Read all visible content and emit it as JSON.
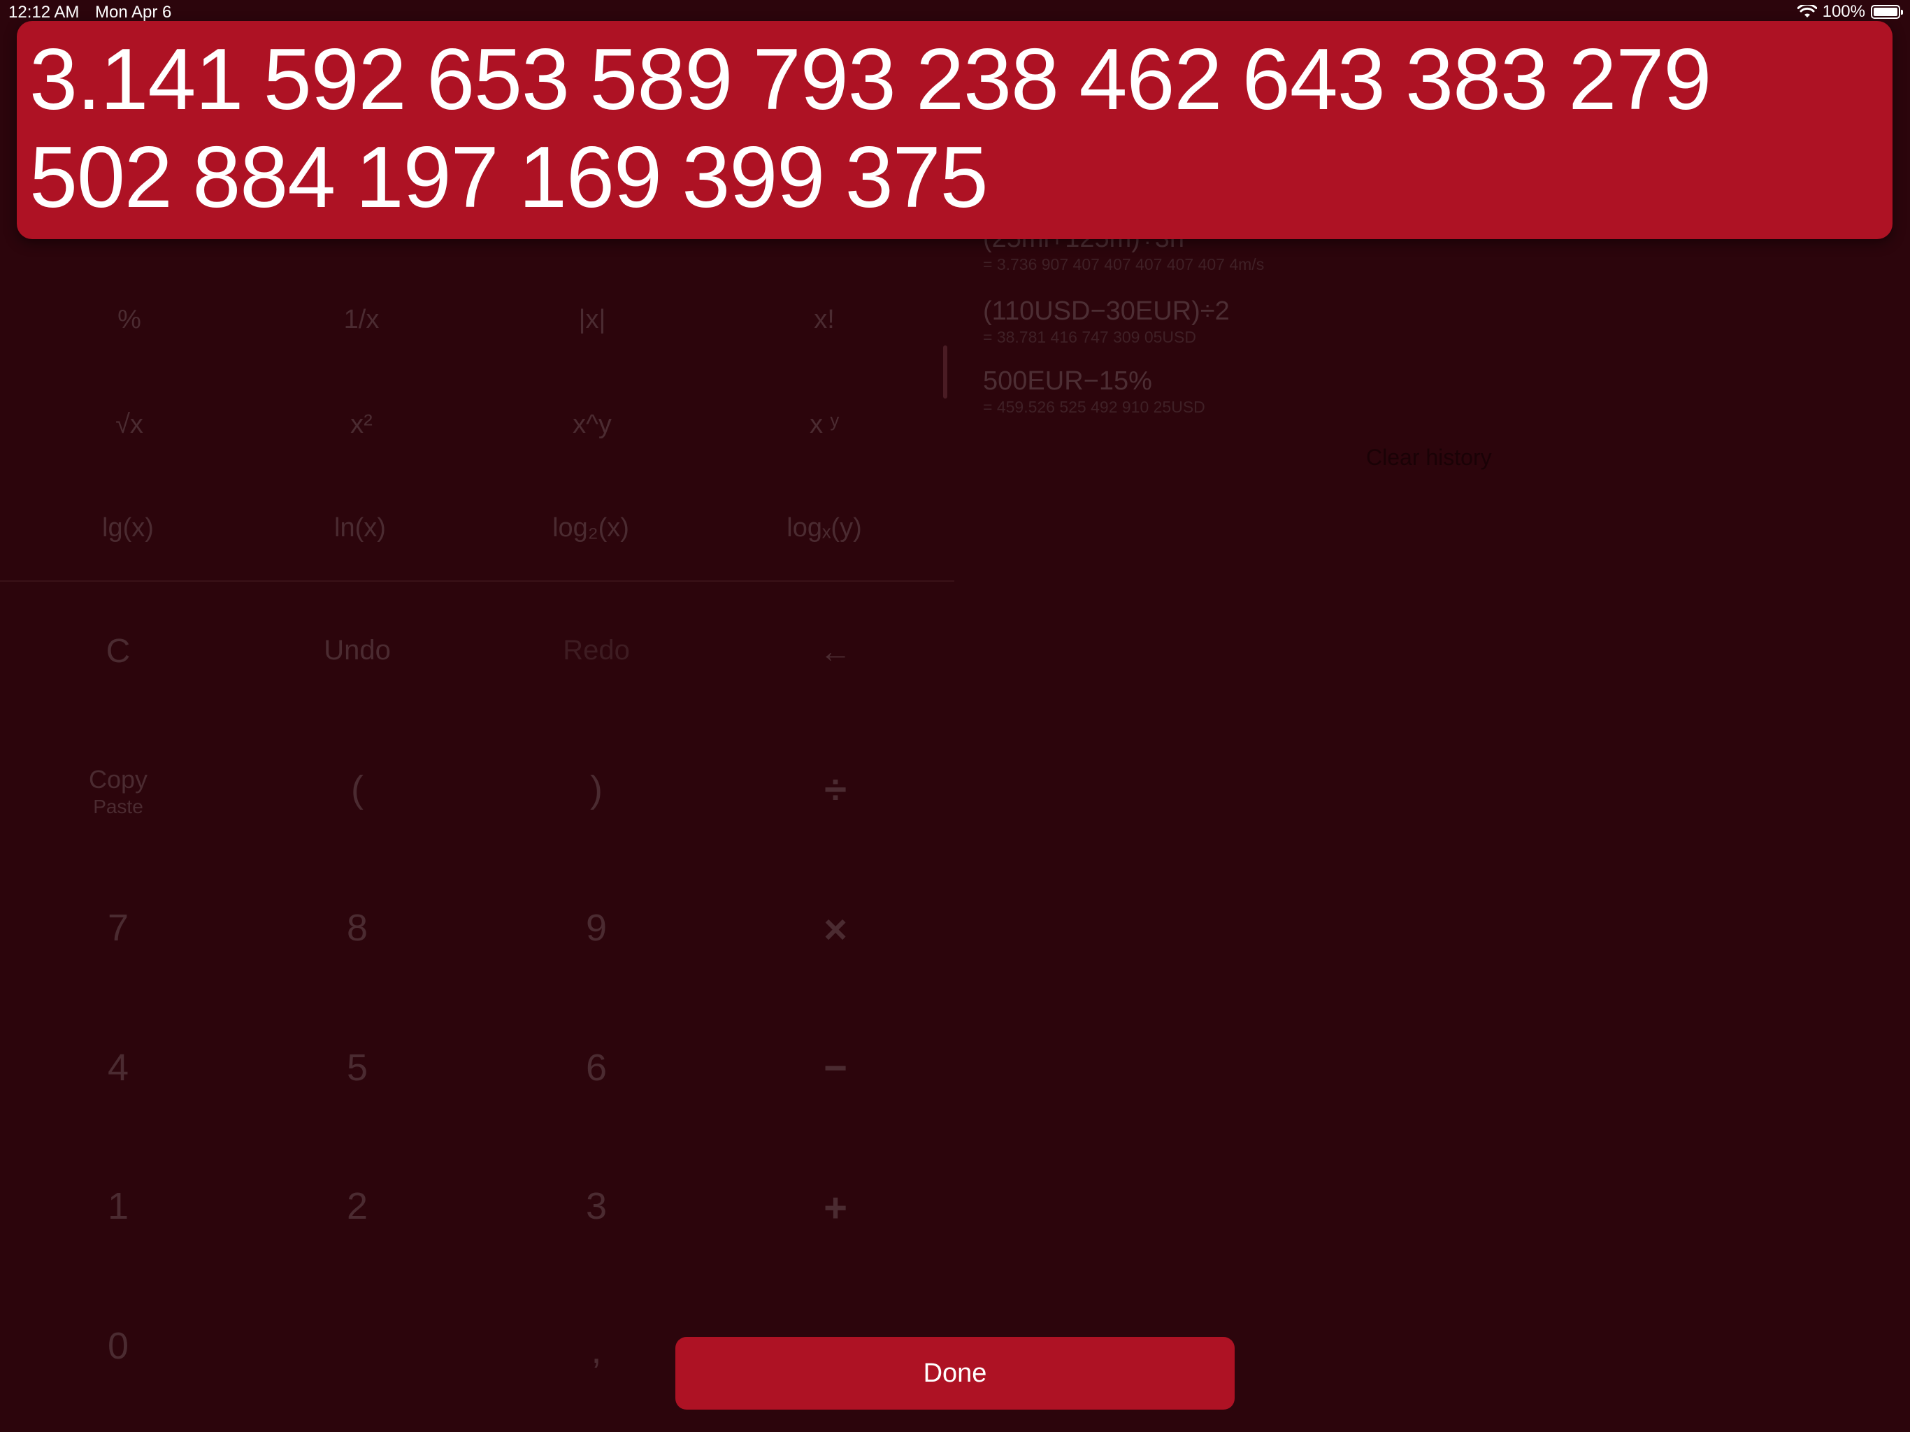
{
  "status_bar": {
    "time": "12:12 AM",
    "date": "Mon Apr 6",
    "battery": "100%"
  },
  "result": {
    "line1": "3.141 592 653 589 793 238 462 643 383 279",
    "line2": "502 884 197 169 399 375"
  },
  "history": {
    "items": [
      {
        "expr": "(25mi+125m)÷3h",
        "result": "= 3.736 907 407 407 407 407 407 4m/s"
      },
      {
        "expr": "(110USD−30EUR)÷2",
        "result": "= 38.781 416 747 309 05USD"
      },
      {
        "expr": "500EUR−15%",
        "result": "= 459.526 525 492 910 25USD"
      }
    ],
    "clear_label": "Clear history"
  },
  "keypad": {
    "functions": {
      "percent": "%",
      "reciprocal": "1/x",
      "abs": "|x|",
      "factorial": "x!",
      "sqrt": "√x",
      "square": "x²",
      "power": "x^y",
      "power_sup": "x ʸ",
      "lg": "lg(x)",
      "ln": "ln(x)",
      "log2": "log₂(x)",
      "logx": "logₓ(y)"
    },
    "controls": {
      "clear": "C",
      "undo": "Undo",
      "redo": "Redo",
      "backspace": "←",
      "copy": "Copy",
      "paste": "Paste",
      "open_paren": "(",
      "close_paren": ")",
      "divide": "÷",
      "multiply": "×",
      "minus": "−",
      "plus": "+",
      "decimal": ","
    },
    "digits": {
      "d0": "0",
      "d1": "1",
      "d2": "2",
      "d3": "3",
      "d4": "4",
      "d5": "5",
      "d6": "6",
      "d7": "7",
      "d8": "8",
      "d9": "9"
    }
  },
  "done_label": "Done",
  "colors": {
    "background": "#2c050c",
    "accent": "#ae1224",
    "dim_text": "#4b2b31"
  }
}
